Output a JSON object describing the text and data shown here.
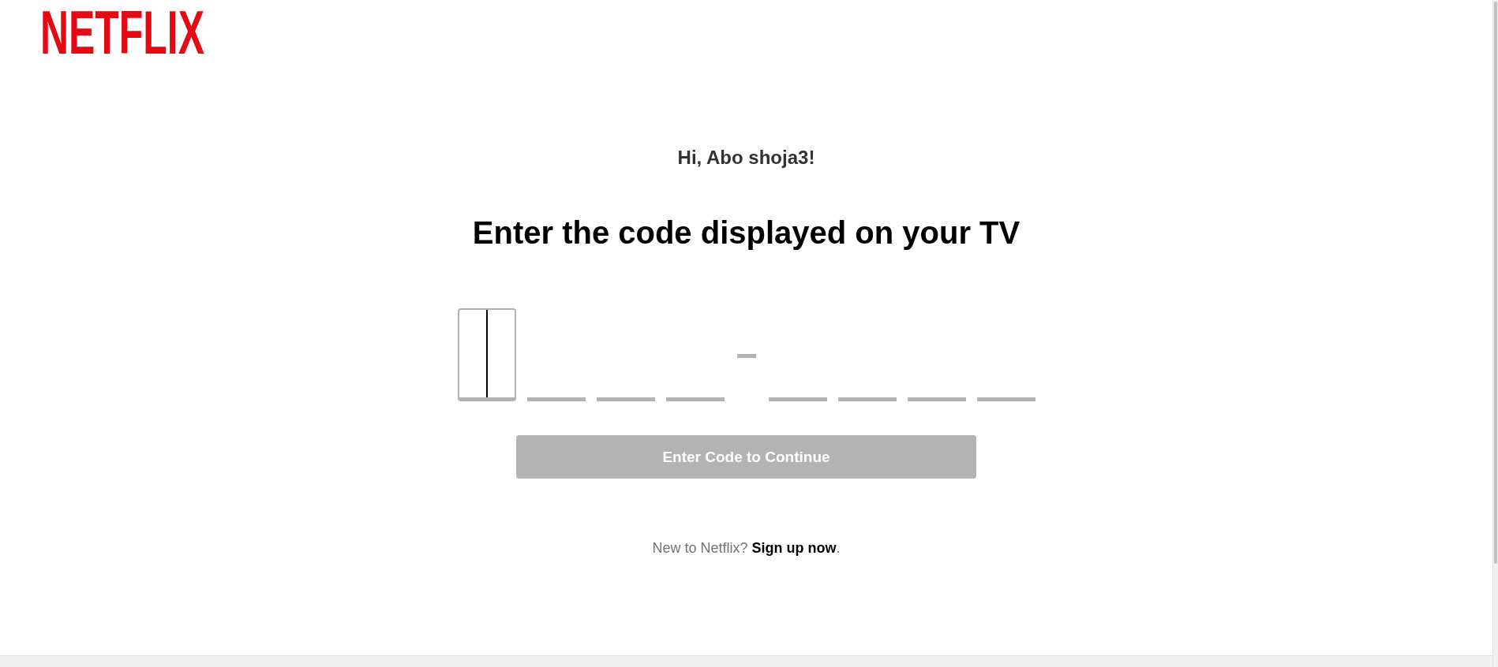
{
  "logo": {
    "text": "NETFLIX"
  },
  "greeting": "Hi, Abo shoja3!",
  "heading": "Enter the code displayed on your TV",
  "code_input": {
    "groups": [
      {
        "slots": [
          {
            "focused": true
          },
          {
            "focused": false
          },
          {
            "focused": false
          },
          {
            "focused": false
          }
        ]
      },
      {
        "slots": [
          {
            "focused": false
          },
          {
            "focused": false
          },
          {
            "focused": false
          },
          {
            "focused": false
          }
        ]
      }
    ]
  },
  "continue_button": {
    "label": "Enter Code to Continue",
    "disabled": true
  },
  "signup": {
    "text": "New to Netflix?",
    "link": "Sign up now",
    "end": "."
  }
}
